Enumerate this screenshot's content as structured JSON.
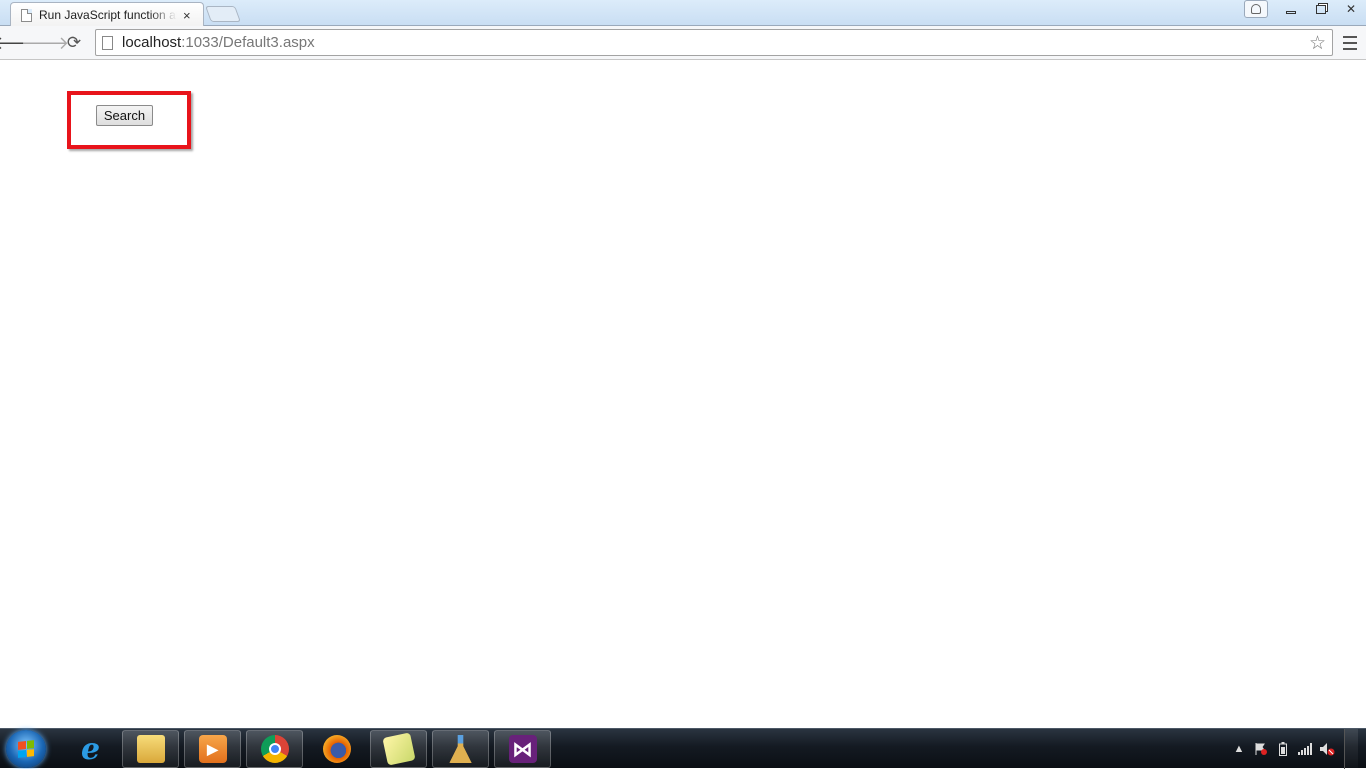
{
  "browser": {
    "tab": {
      "title": "Run JavaScript function at",
      "close_glyph": "×"
    },
    "address_bar": {
      "host": "localhost",
      "rest": ":1033/Default3.aspx"
    },
    "nav": {
      "back_glyph": "🡐",
      "forward_glyph": "🡒",
      "reload_glyph": "⟳"
    },
    "star_glyph": "☆",
    "window_controls": {
      "close_glyph": "✕"
    }
  },
  "page": {
    "search_button_label": "Search",
    "highlight_color": "#e8141b"
  },
  "taskbar": {
    "apps": [
      {
        "name": "internet-explorer-icon",
        "glyph": "e",
        "color": "#2b9be4"
      },
      {
        "name": "file-explorer-icon",
        "glyph": "",
        "color": "#f0c64a"
      },
      {
        "name": "media-player-icon",
        "glyph": "▶",
        "color": "#f08c24"
      },
      {
        "name": "chrome-icon",
        "glyph": "",
        "color": "#3cba54"
      },
      {
        "name": "firefox-icon",
        "glyph": "",
        "color": "#e66000"
      },
      {
        "name": "sticky-notes-icon",
        "glyph": "",
        "color": "#e6dc6a"
      },
      {
        "name": "ccleaner-icon",
        "glyph": "",
        "color": "#d9a441"
      },
      {
        "name": "visual-studio-icon",
        "glyph": "⋈",
        "color": "#68217a"
      }
    ],
    "tray_up_glyph": "▲"
  }
}
